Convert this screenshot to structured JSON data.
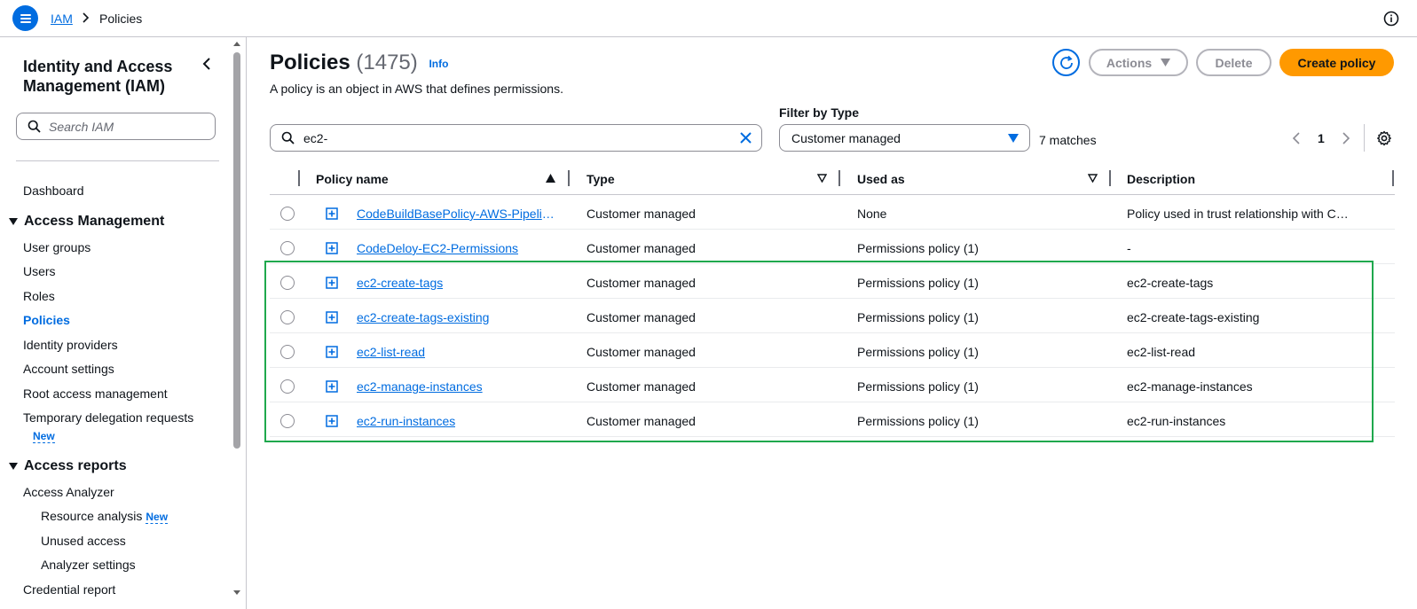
{
  "topbar": {
    "breadcrumb_link": "IAM",
    "breadcrumb_current": "Policies"
  },
  "sidebar": {
    "title": "Identity and Access Management (IAM)",
    "search_placeholder": "Search IAM",
    "dashboard": "Dashboard",
    "access_management": {
      "label": "Access Management",
      "items": [
        "User groups",
        "Users",
        "Roles",
        "Policies",
        "Identity providers",
        "Account settings",
        "Root access management",
        "Temporary delegation requests"
      ],
      "active": "Policies",
      "new_badge": "New"
    },
    "access_reports": {
      "label": "Access reports",
      "analyzer": "Access Analyzer",
      "sub_items": [
        "Resource analysis",
        "Unused access",
        "Analyzer settings"
      ],
      "new_badge": "New",
      "credential_report": "Credential report"
    }
  },
  "main": {
    "title": "Policies",
    "count": "(1475)",
    "info": "Info",
    "description": "A policy is an object in AWS that defines permissions.",
    "buttons": {
      "actions": "Actions",
      "delete": "Delete",
      "create": "Create policy"
    },
    "search_value": "ec2-",
    "filter_label": "Filter by Type",
    "filter_value": "Customer managed",
    "matches": "7 matches",
    "page": "1",
    "columns": [
      "Policy name",
      "Type",
      "Used as",
      "Description"
    ],
    "rows": [
      {
        "name": "CodeBuildBasePolicy-AWS-Pipeline-Managed",
        "type": "Customer managed",
        "used_as": "None",
        "description": "Policy used in trust relationship with CodeBuild"
      },
      {
        "name": "CodeDeloy-EC2-Permissions",
        "type": "Customer managed",
        "used_as": "Permissions policy (1)",
        "description": "-"
      },
      {
        "name": "ec2-create-tags",
        "type": "Customer managed",
        "used_as": "Permissions policy (1)",
        "description": "ec2-create-tags"
      },
      {
        "name": "ec2-create-tags-existing",
        "type": "Customer managed",
        "used_as": "Permissions policy (1)",
        "description": "ec2-create-tags-existing"
      },
      {
        "name": "ec2-list-read",
        "type": "Customer managed",
        "used_as": "Permissions policy (1)",
        "description": "ec2-list-read"
      },
      {
        "name": "ec2-manage-instances",
        "type": "Customer managed",
        "used_as": "Permissions policy (1)",
        "description": "ec2-manage-instances"
      },
      {
        "name": "ec2-run-instances",
        "type": "Customer managed",
        "used_as": "Permissions policy (1)",
        "description": "ec2-run-instances"
      }
    ]
  },
  "colors": {
    "accent": "#006ce0",
    "primary_button": "#ff9900",
    "highlight_border": "#1fa84d"
  }
}
